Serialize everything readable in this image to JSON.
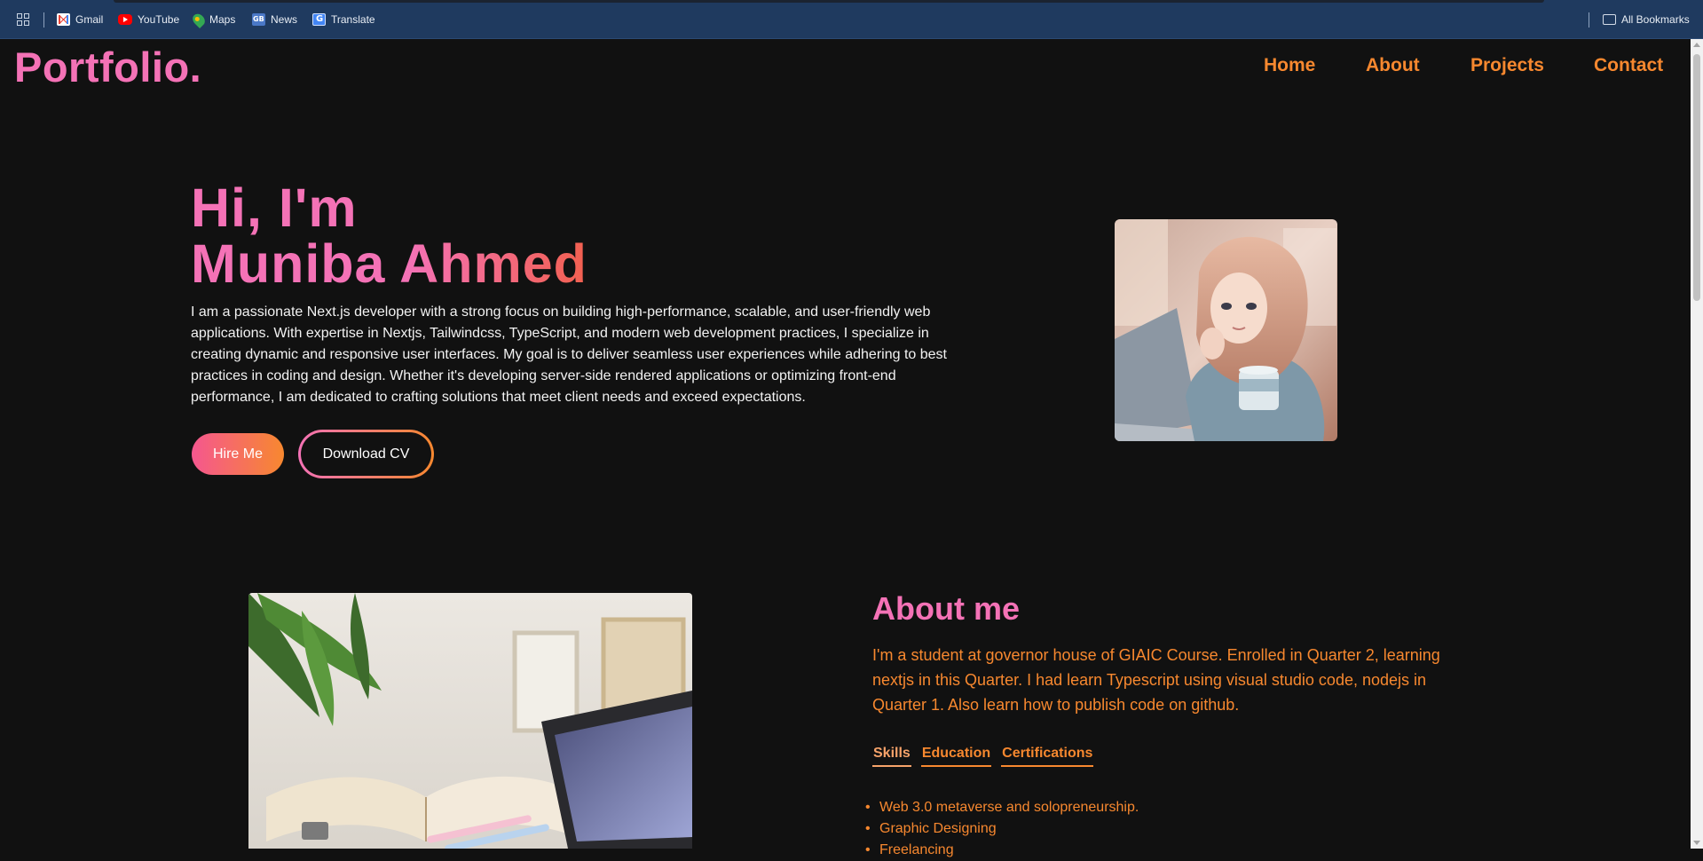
{
  "bookmarks": {
    "items": [
      {
        "label": "Gmail",
        "icon": "gmail-icon"
      },
      {
        "label": "YouTube",
        "icon": "youtube-icon"
      },
      {
        "label": "Maps",
        "icon": "maps-icon"
      },
      {
        "label": "News",
        "icon": "news-icon"
      },
      {
        "label": "Translate",
        "icon": "translate-icon"
      }
    ],
    "all_bookmarks": "All Bookmarks"
  },
  "navbar": {
    "logo": "Portfolio.",
    "links": [
      "Home",
      "About",
      "Projects",
      "Contact"
    ]
  },
  "hero": {
    "greeting": "Hi, I'm",
    "name": "Muniba Ahmed",
    "intro": "I am a passionate Next.js developer with a strong focus on building high-performance, scalable, and user-friendly web applications. With expertise in Nextjs, Tailwindcss, TypeScript, and modern web development practices, I specialize in creating dynamic and responsive user interfaces. My goal is to deliver seamless user experiences while adhering to best practices in coding and design. Whether it's developing server-side rendered applications or optimizing front-end performance, I am dedicated to crafting solutions that meet client needs and exceed expectations.",
    "hire_label": "Hire Me",
    "cv_label": "Download CV"
  },
  "about": {
    "title": "About me",
    "text": "I'm a student at governor house of GIAIC Course. Enrolled in Quarter 2, learning nextjs in this Quarter. I had learn Typescript using visual studio code, nodejs in Quarter 1. Also learn how to publish code on github.",
    "tabs": [
      "Skills",
      "Education",
      "Certifications"
    ],
    "active_tab": "Skills",
    "skills": [
      "Web 3.0 metaverse and solopreneurship.",
      "Graphic Designing",
      "Freelancing"
    ]
  },
  "colors": {
    "pink": "#f472b6",
    "orange": "#f7882f",
    "background": "#111111",
    "bookmarks_bar": "#1f3a5f"
  }
}
